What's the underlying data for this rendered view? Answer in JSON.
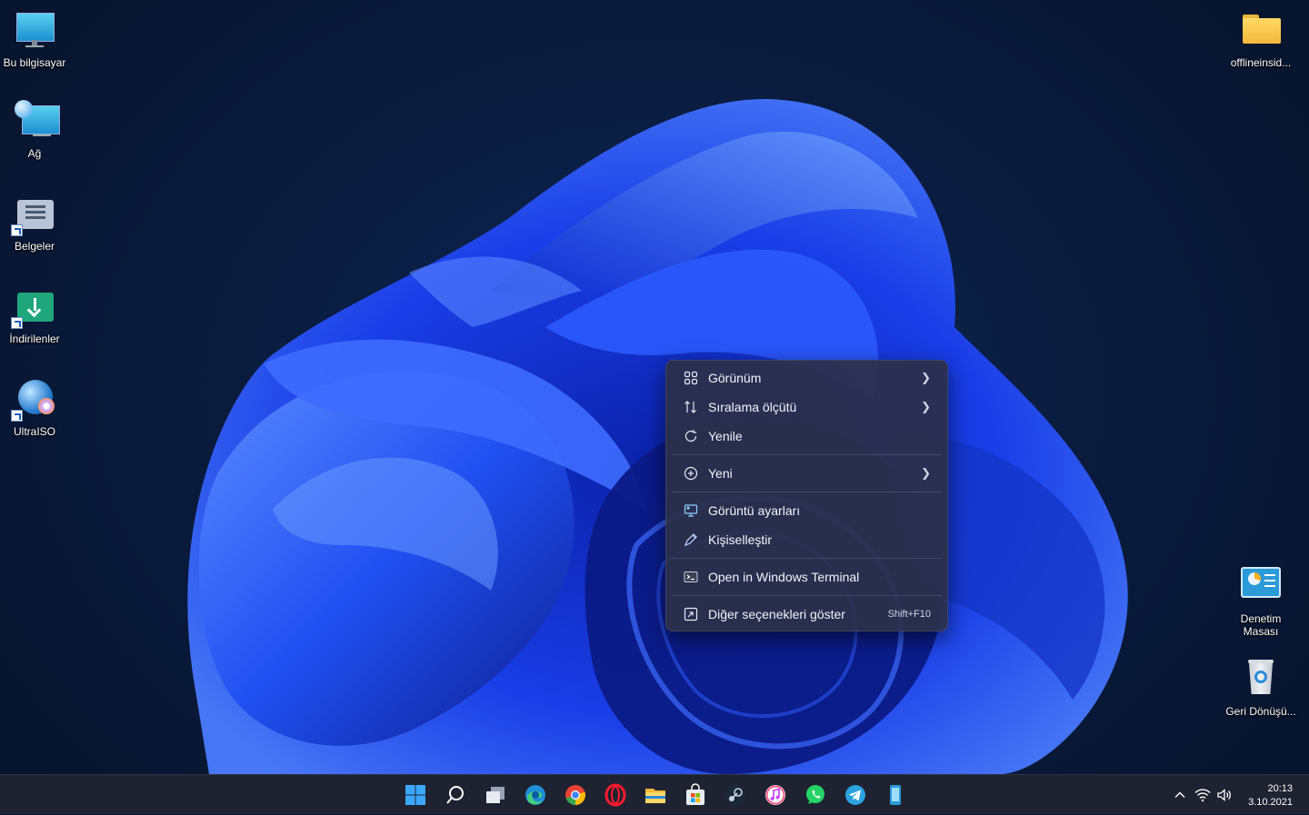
{
  "desktop_icons_left": [
    {
      "name": "this-pc",
      "label": "Bu bilgisayar"
    },
    {
      "name": "network",
      "label": "Ağ"
    },
    {
      "name": "documents",
      "label": "Belgeler"
    },
    {
      "name": "downloads",
      "label": "İndirilenler"
    },
    {
      "name": "ultraiso",
      "label": "UltraISO"
    }
  ],
  "desktop_icons_right": [
    {
      "name": "folder",
      "label": "offlineinsid..."
    },
    {
      "name": "control-panel",
      "label": "Denetim Masası"
    },
    {
      "name": "recycle-bin",
      "label": "Geri Dönüşü..."
    }
  ],
  "context_menu": {
    "items": [
      {
        "label": "Görünüm",
        "icon": "view-grid-icon",
        "submenu": true
      },
      {
        "label": "Sıralama ölçütü",
        "icon": "sort-icon",
        "submenu": true
      },
      {
        "label": "Yenile",
        "icon": "refresh-icon",
        "submenu": false
      },
      {
        "label": "Yeni",
        "icon": "new-plus-icon",
        "submenu": true
      },
      {
        "label": "Görüntü ayarları",
        "icon": "display-settings-icon",
        "submenu": false
      },
      {
        "label": "Kişiselleştir",
        "icon": "personalize-pen-icon",
        "submenu": false
      },
      {
        "label": "Open in Windows Terminal",
        "icon": "terminal-icon",
        "submenu": false
      },
      {
        "label": "Diğer seçenekleri göster",
        "icon": "more-options-icon",
        "shortcut": "Shift+F10"
      }
    ]
  },
  "taskbar": {
    "apps": [
      "start-icon",
      "search-icon",
      "task-view-icon",
      "edge-icon",
      "chrome-icon",
      "opera-icon",
      "file-explorer-icon",
      "store-icon",
      "steam-icon",
      "itunes-icon",
      "whatsapp-icon",
      "telegram-icon",
      "phone-app-icon"
    ],
    "tray_icons": [
      "chevron-up-icon",
      "wifi-icon",
      "volume-icon"
    ],
    "clock_time": "20:13",
    "clock_date": "3.10.2021"
  },
  "colors": {
    "accent": "#2a5bff",
    "menu_bg": "#2c3048",
    "taskbar_bg": "#1f2230"
  }
}
